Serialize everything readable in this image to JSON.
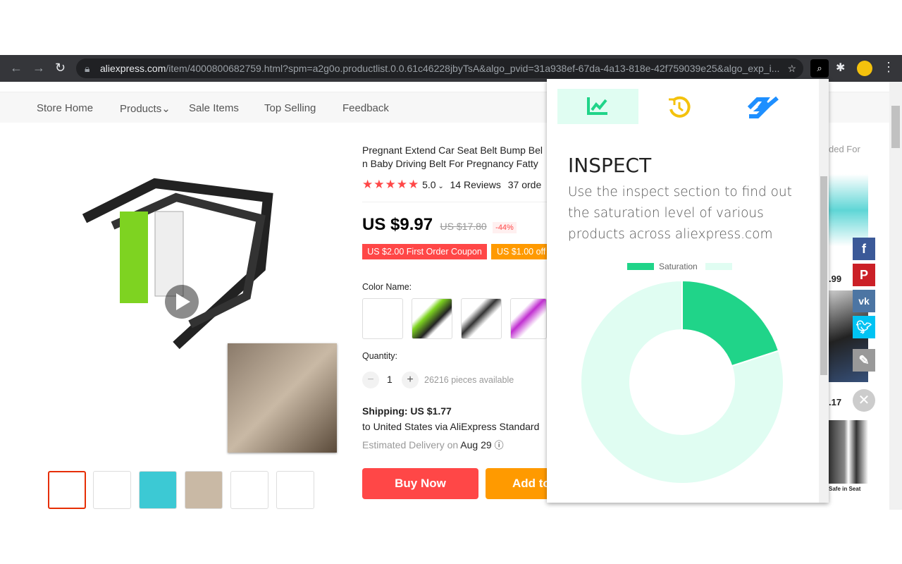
{
  "browser": {
    "url_host": "aliexpress.com",
    "url_path": "/item/4000800682759.html?spm=a2g0o.productlist.0.0.61c46228jbyTsA&algo_pvid=31a938ef-67da-4a13-818e-42f759039e25&algo_exp_i..."
  },
  "store_nav": [
    "Store Home",
    "Products",
    "Sale Items",
    "Top Selling",
    "Feedback"
  ],
  "product": {
    "title_line1": "Pregnant Extend Car Seat Belt Bump Bel",
    "title_line2": "n Baby Driving Belt For Pregnancy Fatty",
    "rating": "5.0",
    "reviews": "14 Reviews",
    "orders": "37 orde",
    "price": "US $9.97",
    "old_price": "US $17.80",
    "discount": "-44%",
    "coupon1": "US $2.00 First Order Coupon",
    "coupon2": "US $1.00 off",
    "color_label": "Color Name:",
    "quantity_label": "Quantity:",
    "quantity": "1",
    "available": "26216 pieces available",
    "shipping": "Shipping: US $1.77",
    "shipping_via": "to United States via AliExpress Standard",
    "delivery_label": "Estimated Delivery on",
    "delivery_date": "Aug 29",
    "buy_now": "Buy Now",
    "add_to_cart": "Add to"
  },
  "sidebar": {
    "heading": "ded For",
    "price1": ".99",
    "price2": ".17",
    "card_text": "Safe in Seat"
  },
  "popup": {
    "heading": "INSPECT",
    "description": "Use the inspect section to find out the saturation level of various products across aliexpress.com",
    "tabs": [
      "trending-chart-icon",
      "history-icon",
      "handshake-icon"
    ]
  },
  "chart_data": {
    "type": "pie",
    "subtype": "donut",
    "categories": [
      "Saturation",
      ""
    ],
    "values": [
      20,
      80
    ],
    "colors": [
      "#20d489",
      "#e0fdf2"
    ],
    "legend": "top"
  },
  "colors": {
    "accent": "#20d489",
    "buy": "#ff4747",
    "cart": "#ff9a00"
  }
}
